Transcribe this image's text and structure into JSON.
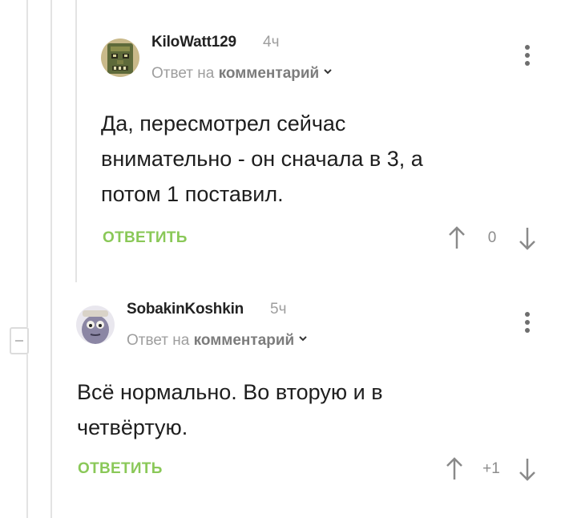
{
  "comments": [
    {
      "username": "KiloWatt129",
      "time": "4ч",
      "reply_prefix": "Ответ на ",
      "reply_target": "комментарий",
      "text_lines": [
        "Да, пересмотрел сейчас",
        "внимательно - он сначала в 3, а",
        "потом 1 поставил."
      ],
      "reply_label": "ОТВЕТИТЬ",
      "rating": "0",
      "avatar": "mayan-mask-avatar"
    },
    {
      "username": "SobakinKoshkin",
      "time": "5ч",
      "reply_prefix": "Ответ на ",
      "reply_target": "комментарий",
      "text_lines": [
        "Всё нормально. Во вторую и в",
        "четвёртую."
      ],
      "reply_label": "ОТВЕТИТЬ",
      "rating": "+1",
      "avatar": "cartoon-character-avatar"
    }
  ],
  "colors": {
    "reply_green": "#8ac858",
    "thread_line": "#e3e3e3",
    "meta_gray": "#9e9e9e"
  },
  "icons": [
    "kebab-menu-icon",
    "chevron-down-icon",
    "upvote-arrow-icon",
    "downvote-arrow-icon",
    "collapse-thread-icon"
  ]
}
